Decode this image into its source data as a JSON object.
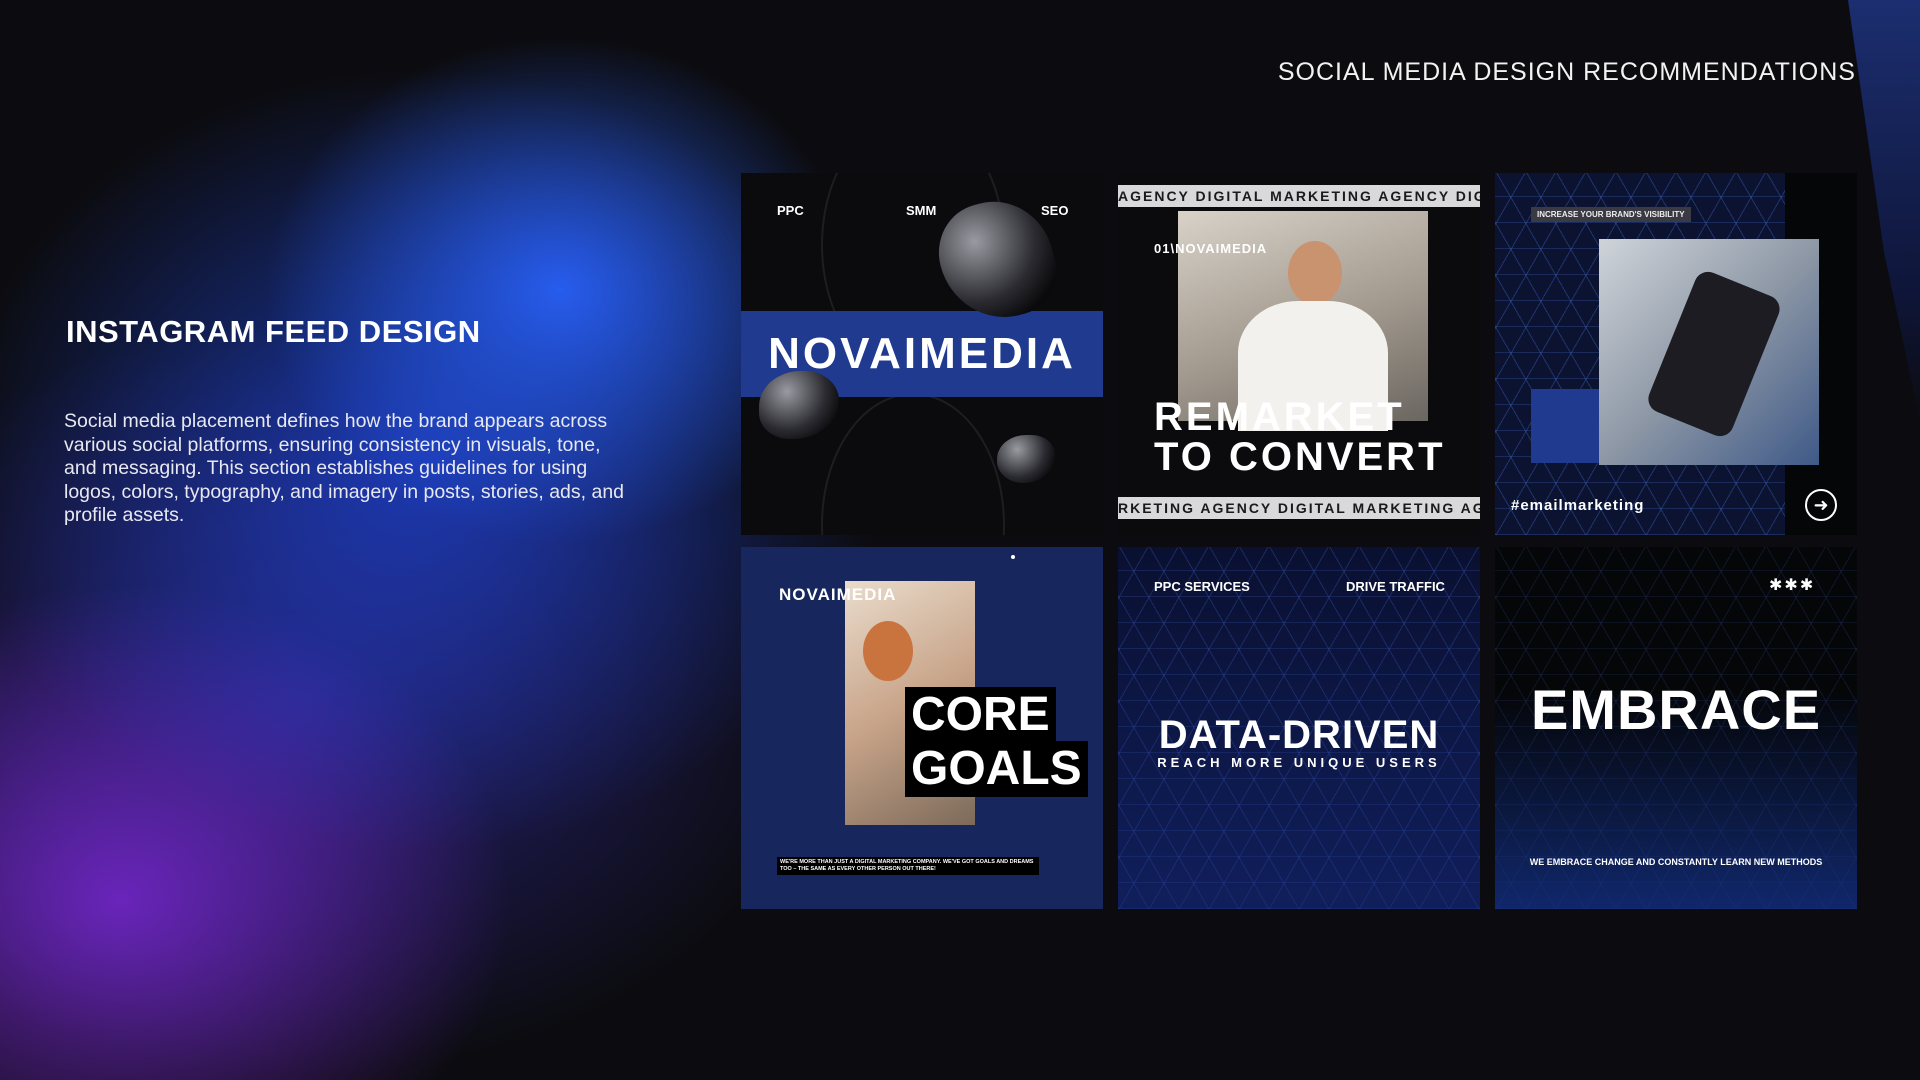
{
  "page": {
    "top_title": "SOCIAL MEDIA DESIGN RECOMMENDATIONS",
    "section_title": "INSTAGRAM FEED DESIGN",
    "section_desc": "Social media placement defines how the brand appears across various social platforms, ensuring consistency in visuals, tone, and messaging. This section establishes guidelines for using logos, colors, typography, and imagery in posts, stories, ads, and profile assets."
  },
  "tiles": {
    "t1": {
      "tag1": "PPC",
      "tag2": "SMM",
      "tag3": "SEO",
      "brand": "NOVAIMEDIA"
    },
    "t2": {
      "ticker_top": "AGENCY DIGITAL MARKETING AGENCY DIGITAL MARKETING",
      "ticker_bottom": "RKETING AGENCY DIGITAL MARKETING AGENCY DIGITAL",
      "label": "01\\NOVAIMEDIA",
      "headline1": "REMARKET",
      "headline2": "TO CONVERT"
    },
    "t3": {
      "badge": "INCREASE YOUR BRAND'S VISIBILITY",
      "hashtag": "#emailmarketing",
      "arrow_icon": "arrow-right-circle-icon"
    },
    "t4": {
      "brand": "NOVAIMEDIA",
      "headline1": "CORE",
      "headline2": "GOALS",
      "caption": "WE'RE MORE THAN JUST A DIGITAL MARKETING COMPANY. WE'VE GOT GOALS AND DREAMS TOO – THE SAME AS EVERY OTHER PERSON OUT THERE!"
    },
    "t5": {
      "tag1": "PPC SERVICES",
      "tag2": "DRIVE TRAFFIC",
      "headline": "DATA-DRIVEN",
      "subline": "REACH MORE UNIQUE USERS"
    },
    "t6": {
      "stars": "✱✱✱",
      "headline": "EMBRACE",
      "caption": "WE EMBRACE CHANGE AND CONSTANTLY LEARN NEW METHODS"
    }
  },
  "colors": {
    "accent_blue": "#1f3a8f",
    "dark": "#0b0b0d"
  }
}
